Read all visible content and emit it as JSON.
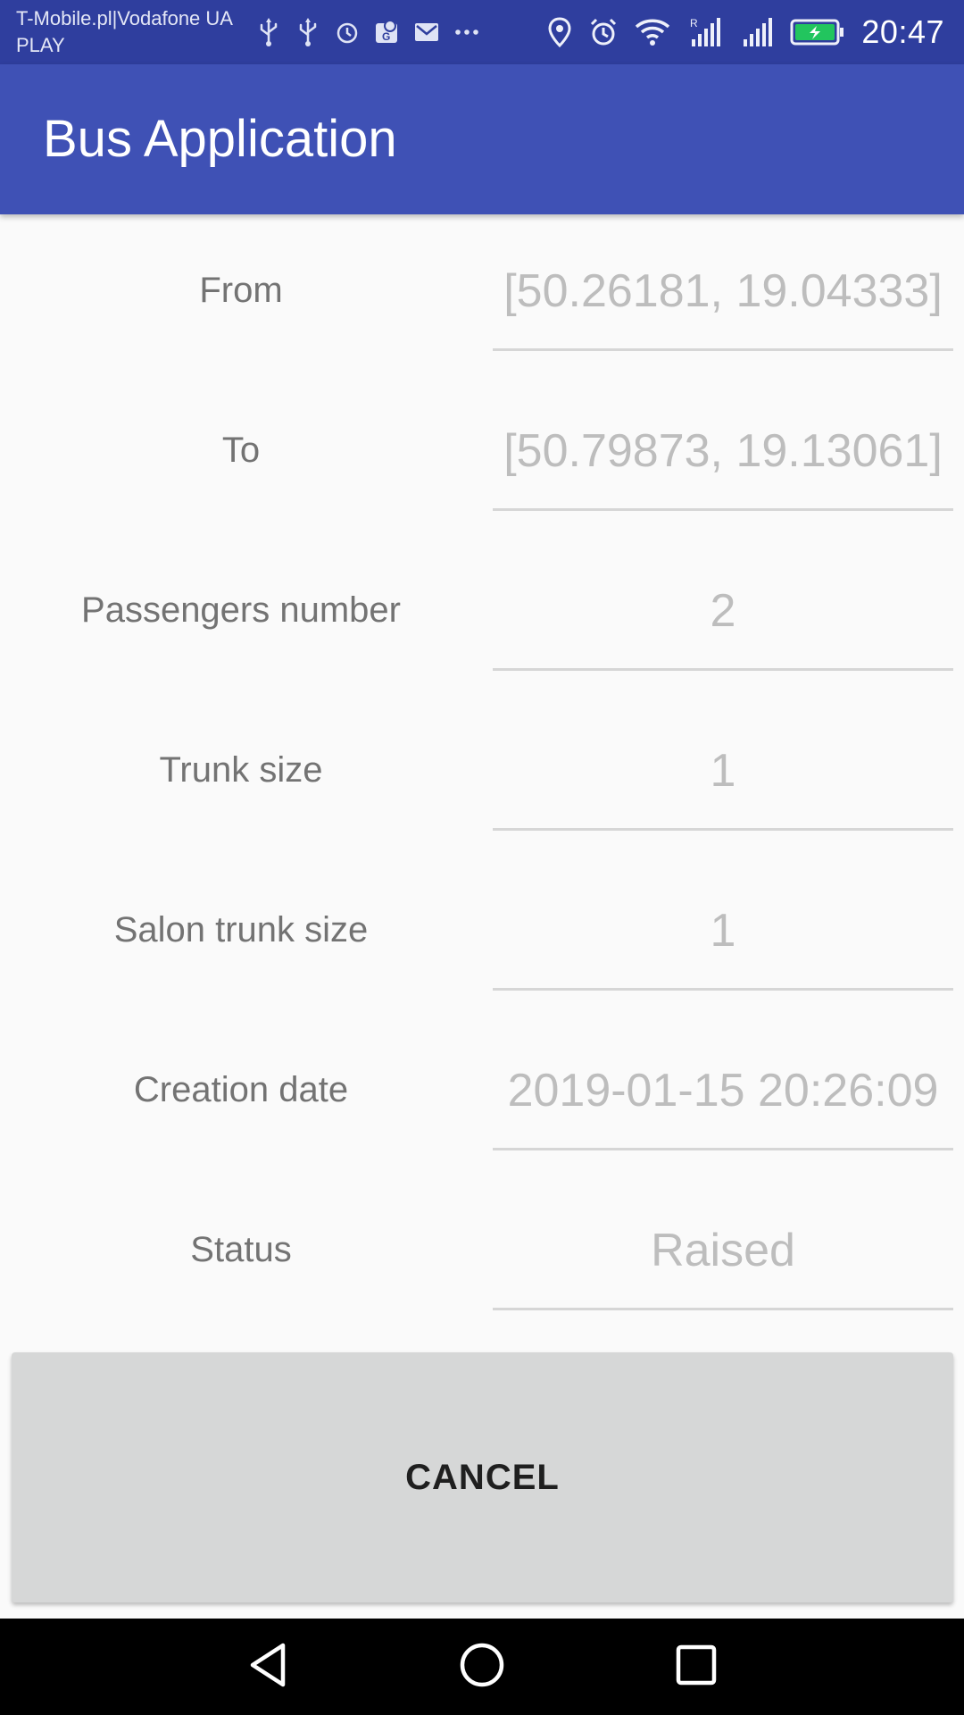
{
  "status_bar": {
    "carrier_line1": "T-Mobile.pl|Vodafone UA",
    "carrier_line2": "PLAY",
    "time": "20:47",
    "left_icons": [
      "usb-icon",
      "usb-icon",
      "alarm-icon",
      "maps-icon",
      "gmail-icon",
      "more-icon"
    ],
    "right_icons": [
      "location-icon",
      "alarm-icon",
      "wifi-icon",
      "signal-roaming-icon",
      "signal-icon",
      "battery-charging-icon"
    ],
    "roaming_label": "R",
    "battery_color": "#22c55e"
  },
  "app_bar": {
    "title": "Bus Application",
    "color": "#3f51b5"
  },
  "form": {
    "rows": [
      {
        "label": "From",
        "value": "[50.26181, 19.04333]"
      },
      {
        "label": "To",
        "value": "[50.79873, 19.13061]"
      },
      {
        "label": "Passengers number",
        "value": "2"
      },
      {
        "label": "Trunk size",
        "value": "1"
      },
      {
        "label": "Salon trunk size",
        "value": "1"
      },
      {
        "label": "Creation date",
        "value": "2019-01-15 20:26:09"
      },
      {
        "label": "Status",
        "value": "Raised"
      }
    ]
  },
  "actions": {
    "cancel_label": "CANCEL"
  },
  "nav_bar": {
    "buttons": [
      "back-icon",
      "home-icon",
      "recents-icon"
    ]
  }
}
